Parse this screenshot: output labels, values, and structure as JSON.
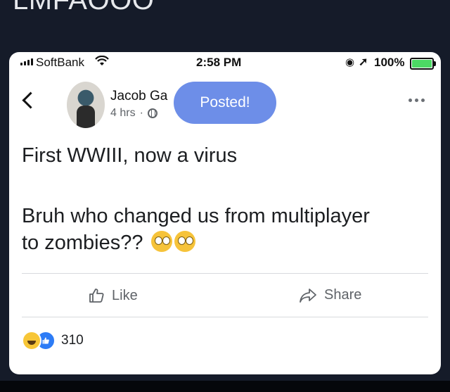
{
  "caption": "LMFAOOO",
  "status_bar": {
    "carrier": "SoftBank",
    "time": "2:58 PM",
    "battery": "100%"
  },
  "post": {
    "author": "Jacob Ga",
    "timestamp": "4 hrs",
    "toast": "Posted!",
    "line1": "First WWIII, now a virus",
    "line2": "Bruh who changed us from multiplayer",
    "line3": "to zombies??",
    "emoji": "face-with-rolling-eyes"
  },
  "actions": {
    "like": "Like",
    "share": "Share"
  },
  "reactions": {
    "count": "310",
    "types": [
      "haha",
      "like"
    ]
  },
  "colors": {
    "toast": "#6d8ee8",
    "like_blue": "#2d7cf6",
    "background": "#151b29"
  }
}
